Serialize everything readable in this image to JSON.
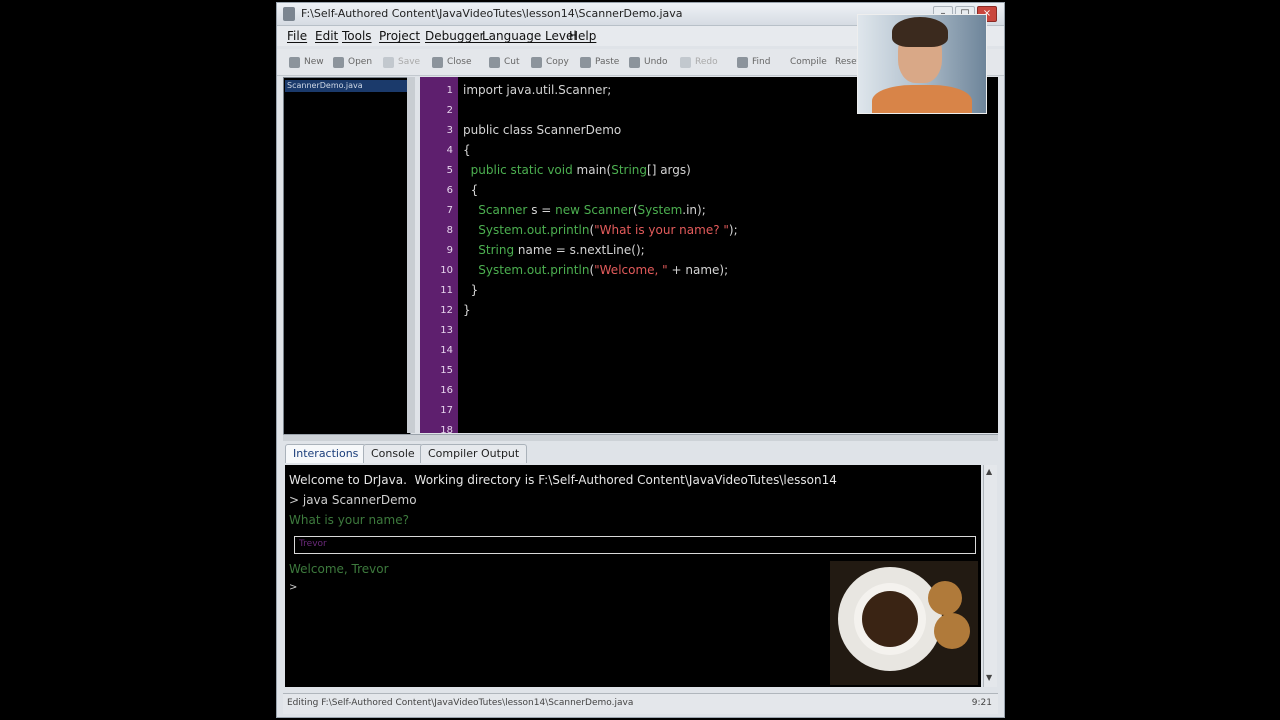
{
  "window": {
    "title": "F:\\Self-Authored Content\\JavaVideoTutes\\lesson14\\ScannerDemo.java"
  },
  "menu": [
    "File",
    "Edit",
    "Tools",
    "Project",
    "Debugger",
    "Language Level",
    "Help"
  ],
  "toolbar": {
    "new": "New",
    "open": "Open",
    "save": "Save",
    "close": "Close",
    "cut": "Cut",
    "copy": "Copy",
    "paste": "Paste",
    "undo": "Undo",
    "redo": "Redo",
    "find": "Find",
    "compile": "Compile",
    "reset": "Reset"
  },
  "files": [
    "ScannerDemo.java"
  ],
  "editor": {
    "line_numbers": [
      "1",
      "2",
      "3",
      "4",
      "5",
      "6",
      "7",
      "8",
      "9",
      "10",
      "11",
      "12",
      "13",
      "14",
      "15",
      "16",
      "17",
      "18"
    ]
  },
  "tabs": [
    "Interactions",
    "Console",
    "Compiler Output"
  ],
  "console": {
    "welcome": "Welcome to DrJava.  Working directory is F:\\Self-Authored Content\\JavaVideoTutes\\lesson14",
    "command": "> java ScannerDemo",
    "prompt": "What is your name?",
    "input_value": "Trevor",
    "output": "Welcome, Trevor",
    "cursor_prompt": ">"
  },
  "status": {
    "text": "Editing F:\\Self-Authored Content\\JavaVideoTutes\\lesson14\\ScannerDemo.java",
    "position": "9:21"
  },
  "colors": {
    "gutter": "#5e1f6e",
    "keyword": "#4caf50",
    "string": "#e35b5b"
  }
}
